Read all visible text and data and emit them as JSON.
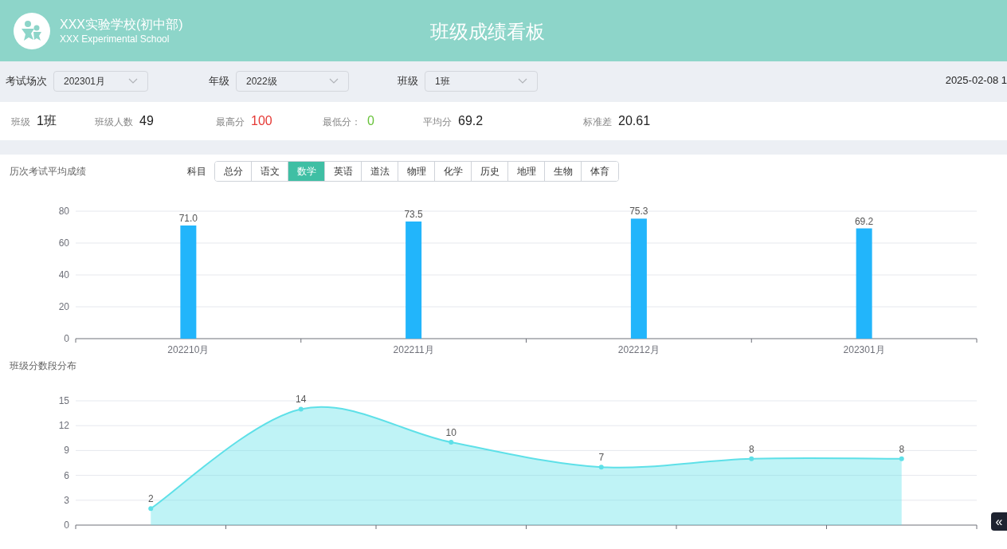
{
  "header": {
    "school_name": "XXX实验学校(初中部)",
    "school_name_en": "XXX Experimental School",
    "title": "班级成绩看板"
  },
  "filters": [
    {
      "label": "考试场次",
      "value": "202301月"
    },
    {
      "label": "年级",
      "value": "2022级"
    },
    {
      "label": "班级",
      "value": "1班"
    }
  ],
  "datetime": "2025-02-08 1",
  "stats": [
    {
      "label": "班级",
      "value": "1班",
      "color": "#222222"
    },
    {
      "label": "班级人数",
      "value": "49",
      "color": "#222222"
    },
    {
      "label": "最高分",
      "value": "100",
      "color": "#e53935"
    },
    {
      "label": "最低分：",
      "value": "0",
      "color": "#67c23a"
    },
    {
      "label": "平均分",
      "value": "69.2",
      "color": "#222222"
    },
    {
      "label": "标准差",
      "value": "20.61",
      "color": "#222222"
    }
  ],
  "avg_chart": {
    "title": "历次考试平均成绩",
    "subject_label": "科目",
    "subjects": [
      {
        "label": "总分",
        "selected": false
      },
      {
        "label": "语文",
        "selected": false
      },
      {
        "label": "数学",
        "selected": true
      },
      {
        "label": "英语",
        "selected": false
      },
      {
        "label": "道法",
        "selected": false
      },
      {
        "label": "物理",
        "selected": false
      },
      {
        "label": "化学",
        "selected": false
      },
      {
        "label": "历史",
        "selected": false
      },
      {
        "label": "地理",
        "selected": false
      },
      {
        "label": "生物",
        "selected": false
      },
      {
        "label": "体育",
        "selected": false
      }
    ],
    "chart_data": {
      "type": "bar",
      "categories": [
        "202210月",
        "202211月",
        "202212月",
        "202301月"
      ],
      "series": [
        {
          "color": "#22b5fb",
          "values": [
            71.0,
            73.5,
            75.3,
            69.2
          ]
        }
      ],
      "grid": true,
      "ylim": [
        0,
        80
      ],
      "yticks": [
        0,
        20,
        40,
        60,
        80
      ],
      "value_labels": [
        "71.0",
        "73.5",
        "75.3",
        "69.2"
      ]
    }
  },
  "dist_chart": {
    "title": "班级分数段分布",
    "chart_data": {
      "type": "area",
      "series": [
        {
          "color": "#5ee0e8",
          "values": [
            2,
            14,
            10,
            7,
            8,
            8
          ]
        }
      ],
      "grid": true,
      "ylim": [
        0,
        15
      ],
      "yticks": [
        0,
        3,
        6,
        9,
        12,
        15
      ],
      "value_labels": [
        "2",
        "14",
        "10",
        "7",
        "8",
        "8"
      ]
    }
  },
  "collapse_button": "«"
}
